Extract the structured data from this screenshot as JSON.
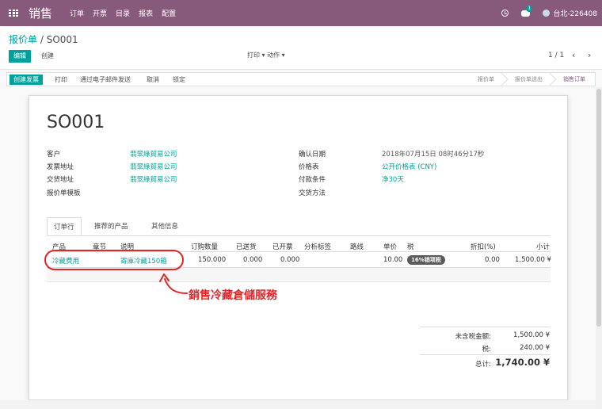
{
  "topbar": {
    "app_name": "销售",
    "menu": [
      "订单",
      "开票",
      "目录",
      "报表",
      "配置"
    ],
    "chat_badge": "1",
    "user_name": "台北-226408"
  },
  "control_panel": {
    "breadcrumb_parent": "报价单",
    "breadcrumb_sep": "/",
    "breadcrumb_current": "SO001",
    "edit_label": "编辑",
    "create_label": "创建",
    "print_label": "打印 ▾",
    "action_label": "动作 ▾",
    "pager": "1 / 1",
    "pager_nav": "‹ ›"
  },
  "statusbar": {
    "create_invoice": "创建发票",
    "print": "打印",
    "send_email": "通过电子邮件发送",
    "cancel": "取消",
    "lock": "锁定",
    "stages": [
      "报价单",
      "报价单送出",
      "销售订单"
    ],
    "active_stage": 2
  },
  "form": {
    "name": "SO001",
    "left_fields": [
      {
        "label": "客户",
        "value": "翡翠綠貿易公司"
      },
      {
        "label": "发票地址",
        "value": "翡翠綠貿易公司"
      },
      {
        "label": "交货地址",
        "value": "翡翠綠貿易公司"
      },
      {
        "label": "报价单模板",
        "value": ""
      }
    ],
    "right_fields": [
      {
        "label": "确认日期",
        "value": "2018年07月15日 08时46分17秒"
      },
      {
        "label": "价格表",
        "value": "公开价格表 (CNY)"
      },
      {
        "label": "付款条件",
        "value": "净30天"
      },
      {
        "label": "交货方法",
        "value": ""
      }
    ]
  },
  "tabs": [
    "订单行",
    "推荐的产品",
    "其他信息"
  ],
  "order_lines": {
    "headers": [
      "产品",
      "章节",
      "说明",
      "订购数量",
      "已送货",
      "已开票",
      "分析标签",
      "路线",
      "单价",
      "税",
      "折扣(%)",
      "小计"
    ],
    "rows": [
      {
        "product": "冷藏费用",
        "section": "",
        "description": "寄庫冷藏150箱",
        "qty": "150.000",
        "delivered": "0.000",
        "invoiced": "0.000",
        "price": "10.00",
        "tax": "16%销项税",
        "discount": "0.00",
        "subtotal": "1,500.00 ¥"
      }
    ]
  },
  "annotation": {
    "text": "銷售冷藏倉儲服務",
    "color": "#e3262a"
  },
  "totals": {
    "untaxed_label": "未含税金额:",
    "untaxed_value": "1,500.00 ¥",
    "tax_label": "税:",
    "tax_value": "240.00 ¥",
    "total_label": "总计:",
    "total_value": "1,740.00 ¥"
  },
  "colors": {
    "brand": "#875a7b",
    "accent": "#00a09d"
  }
}
